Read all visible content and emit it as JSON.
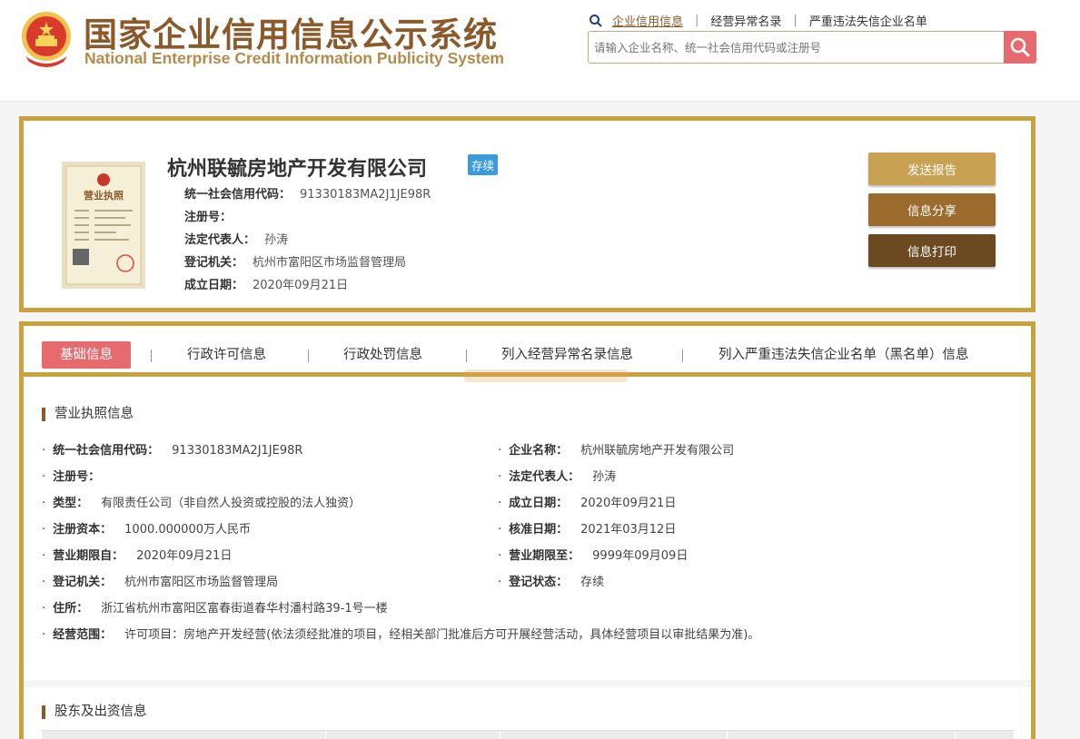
{
  "header": {
    "title_cn": "国家企业信用信息公示系统",
    "title_en": "National Enterprise Credit Information Publicity System",
    "links": [
      "企业信用信息",
      "经营异常名录",
      "严重违法失信企业名单"
    ],
    "search_placeholder": "请输入企业名称、统一社会信用代码或注册号"
  },
  "company": {
    "name": "杭州联毓房地产开发有限公司",
    "status": "存续",
    "rows": [
      {
        "label": "统一社会信用代码：",
        "value": "91330183MA2J1JE98R"
      },
      {
        "label": "注册号：",
        "value": ""
      },
      {
        "label": "法定代表人：",
        "value": "孙涛"
      },
      {
        "label": "登记机关：",
        "value": "杭州市富阳区市场监督管理局"
      },
      {
        "label": "成立日期：",
        "value": "2020年09月21日"
      }
    ],
    "license_caption": "营业执照"
  },
  "actions": {
    "report": "发送报告",
    "share": "信息分享",
    "print": "信息打印"
  },
  "tabs": [
    "基础信息",
    "行政许可信息",
    "行政处罚信息",
    "列入经营异常名录信息",
    "列入严重违法失信企业名单（黑名单）信息"
  ],
  "license_section": {
    "title": "营业执照信息",
    "left": [
      {
        "label": "统一社会信用代码：",
        "value": "91330183MA2J1JE98R"
      },
      {
        "label": "注册号：",
        "value": ""
      },
      {
        "label": "类型：",
        "value": "有限责任公司（非自然人投资或控股的法人独资）"
      },
      {
        "label": "注册资本：",
        "value": "1000.000000万人民币"
      },
      {
        "label": "营业期限自：",
        "value": "2020年09月21日"
      },
      {
        "label": "登记机关：",
        "value": "杭州市富阳区市场监督管理局"
      },
      {
        "label": "住所：",
        "value": "浙江省杭州市富阳区富春街道春华村潘村路39-1号一楼"
      },
      {
        "label": "经营范围：",
        "value": "许可项目：房地产开发经营(依法须经批准的项目，经相关部门批准后方可开展经营活动，具体经营项目以审批结果为准)。"
      }
    ],
    "right": [
      {
        "label": "企业名称：",
        "value": "杭州联毓房地产开发有限公司"
      },
      {
        "label": "法定代表人：",
        "value": "孙涛"
      },
      {
        "label": "成立日期：",
        "value": "2020年09月21日"
      },
      {
        "label": "核准日期：",
        "value": "2021年03月12日"
      },
      {
        "label": "营业期限至：",
        "value": "9999年09月09日"
      },
      {
        "label": "登记状态：",
        "value": "存续"
      }
    ]
  },
  "shareholder_section": {
    "title": "股东及出资信息"
  },
  "colors": {
    "gold_border": "#c9a23e",
    "brown_title": "#8b5a2b",
    "accent_red": "#e76a6e",
    "status_blue": "#3a9bdc"
  }
}
